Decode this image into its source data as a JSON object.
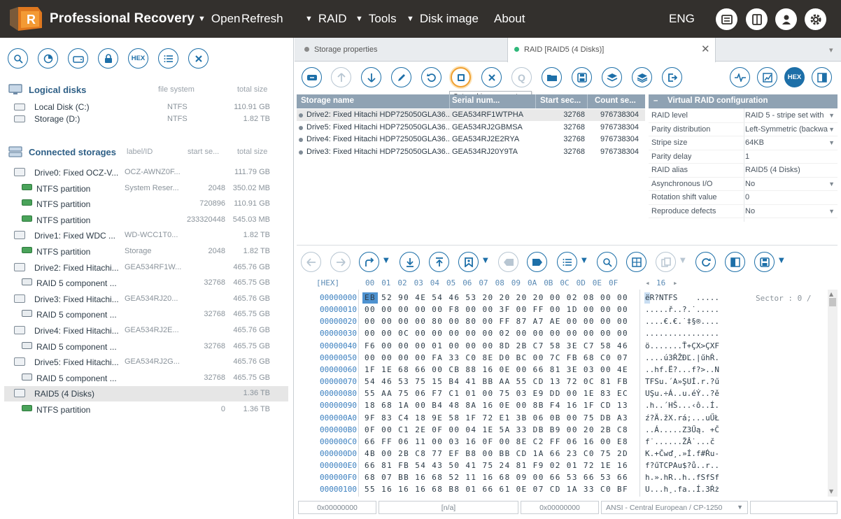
{
  "app": {
    "title": "Professional Recovery",
    "menu": [
      {
        "label": "Open",
        "has_arrow": true
      },
      {
        "label": "Refresh",
        "has_arrow": false
      },
      {
        "label": "RAID",
        "has_arrow": true
      },
      {
        "label": "Tools",
        "has_arrow": true
      },
      {
        "label": "Disk image",
        "has_arrow": true
      },
      {
        "label": "About",
        "has_arrow": false
      }
    ],
    "language": "ENG",
    "arrow": "▼"
  },
  "left": {
    "toolbar_hex": "HEX",
    "logical": {
      "title": "Logical disks",
      "col_fs": "file system",
      "col_size": "total size",
      "items": [
        {
          "name": "Local Disk (C:)",
          "fs": "NTFS",
          "size": "110.91 GB"
        },
        {
          "name": "Storage (D:)",
          "fs": "NTFS",
          "size": "1.82 TB"
        }
      ]
    },
    "connected": {
      "title": "Connected storages",
      "col_label": "label/ID",
      "col_start": "start se...",
      "col_size": "total size",
      "items": [
        {
          "kind": "drive",
          "name": "Drive0: Fixed OCZ-V...",
          "label": "OCZ-AWNZ0F...",
          "start": "",
          "size": "111.79 GB"
        },
        {
          "kind": "part",
          "name": "NTFS partition",
          "label": "System Reser...",
          "start": "2048",
          "size": "350.02 MB"
        },
        {
          "kind": "part",
          "name": "NTFS partition",
          "label": "",
          "start": "720896",
          "size": "110.91 GB"
        },
        {
          "kind": "part",
          "name": "NTFS partition",
          "label": "",
          "start": "233320448",
          "size": "545.03 MB"
        },
        {
          "kind": "drive",
          "name": "Drive1: Fixed WDC ...",
          "label": "WD-WCC1T0...",
          "start": "",
          "size": "1.82 TB"
        },
        {
          "kind": "part",
          "name": "NTFS partition",
          "label": "Storage",
          "start": "2048",
          "size": "1.82 TB"
        },
        {
          "kind": "drive",
          "name": "Drive2: Fixed Hitachi...",
          "label": "GEA534RF1W...",
          "start": "",
          "size": "465.76 GB"
        },
        {
          "kind": "raid",
          "name": "RAID 5 component ...",
          "label": "",
          "start": "32768",
          "size": "465.75 GB"
        },
        {
          "kind": "drive",
          "name": "Drive3: Fixed Hitachi...",
          "label": "GEA534RJ20...",
          "start": "",
          "size": "465.76 GB"
        },
        {
          "kind": "raid",
          "name": "RAID 5 component ...",
          "label": "",
          "start": "32768",
          "size": "465.75 GB"
        },
        {
          "kind": "drive",
          "name": "Drive4: Fixed Hitachi...",
          "label": "GEA534RJ2E...",
          "start": "",
          "size": "465.76 GB"
        },
        {
          "kind": "raid",
          "name": "RAID 5 component ...",
          "label": "",
          "start": "32768",
          "size": "465.75 GB"
        },
        {
          "kind": "drive",
          "name": "Drive5: Fixed Hitachi...",
          "label": "GEA534RJ2G...",
          "start": "",
          "size": "465.76 GB"
        },
        {
          "kind": "raid",
          "name": "RAID 5 component ...",
          "label": "",
          "start": "32768",
          "size": "465.75 GB"
        },
        {
          "kind": "drive",
          "name": "RAID5 (4 Disks)",
          "label": "",
          "start": "",
          "size": "1.36 TB",
          "selected": true
        },
        {
          "kind": "part",
          "name": "NTFS partition",
          "label": "",
          "start": "0",
          "size": "1.36 TB"
        }
      ]
    }
  },
  "tabs": [
    {
      "label": "Storage properties",
      "active": false,
      "dot": "#8a8a8a"
    },
    {
      "label": "RAID [RAID5 (4 Disks)]",
      "active": true,
      "dot": "#2fb87a"
    }
  ],
  "tooltip": "Set caching parameters",
  "hex_button": "HEX",
  "storage_table": {
    "headers": [
      "Storage name",
      "Serial num...",
      "Start sec...",
      "Count se..."
    ],
    "rows": [
      {
        "name": "Drive2: Fixed Hitachi HDP725050GLA36...",
        "serial": "GEA534RF1WTPHA",
        "start": "32768",
        "count": "976738304"
      },
      {
        "name": "Drive5: Fixed Hitachi HDP725050GLA36...",
        "serial": "GEA534RJ2GBMSA",
        "start": "32768",
        "count": "976738304"
      },
      {
        "name": "Drive4: Fixed Hitachi HDP725050GLA36...",
        "serial": "GEA534RJ2E2RYA",
        "start": "32768",
        "count": "976738304"
      },
      {
        "name": "Drive3: Fixed Hitachi HDP725050GLA36...",
        "serial": "GEA534RJ20Y9TA",
        "start": "32768",
        "count": "976738304"
      }
    ]
  },
  "raid_config": {
    "title": "Virtual RAID configuration",
    "collapse": "–",
    "rows": [
      {
        "key": "RAID level",
        "value": "RAID 5 - stripe set with",
        "dropdown": true
      },
      {
        "key": "Parity distribution",
        "value": "Left-Symmetric (backwa",
        "dropdown": true
      },
      {
        "key": "Stripe size",
        "value": "64KB",
        "dropdown": true
      },
      {
        "key": "Parity delay",
        "value": "1",
        "dropdown": false
      },
      {
        "key": "RAID alias",
        "value": "RAID5 (4 Disks)",
        "dropdown": false
      },
      {
        "key": "Asynchronous I/O",
        "value": "No",
        "dropdown": true
      },
      {
        "key": "Rotation shift value",
        "value": "0",
        "dropdown": false
      },
      {
        "key": "Reproduce defects",
        "value": "No",
        "dropdown": true
      }
    ]
  },
  "hex": {
    "header_label": "[HEX]",
    "columns": [
      "00",
      "01",
      "02",
      "03",
      "04",
      "05",
      "06",
      "07",
      "08",
      "09",
      "0A",
      "0B",
      "0C",
      "0D",
      "0E",
      "0F"
    ],
    "width_label": "16",
    "sector_label": "Sector : 0 /",
    "rows": [
      {
        "addr": "00000000",
        "bytes": "EB 52 90 4E 54 46 53 20 20 20 20 00 02 08 00 00",
        "text": "ëR?NTFS    ....."
      },
      {
        "addr": "00000010",
        "bytes": "00 00 00 00 00 F8 00 00 3F 00 FF 00 1D 00 00 00",
        "text": ".....ř..?.˙....."
      },
      {
        "addr": "00000020",
        "bytes": "00 00 00 00 80 00 80 00 FF 87 A7 AE 00 00 00 00",
        "text": "....€.€.˙‡§®...."
      },
      {
        "addr": "00000030",
        "bytes": "00 00 0C 00 00 00 00 00 02 00 00 00 00 00 00 00",
        "text": "................"
      },
      {
        "addr": "00000040",
        "bytes": "F6 00 00 00 01 00 00 00 8D 2B C7 58 3E C7 58 46",
        "text": "ö.......Ť+ÇX>ÇXF"
      },
      {
        "addr": "00000050",
        "bytes": "00 00 00 00 FA 33 C0 8E D0 BC 00 7C FB 68 C0 07",
        "text": "....ú3ŔŽĐĽ.|űhŔ."
      },
      {
        "addr": "00000060",
        "bytes": "1F 1E 68 66 00 CB 88 16 0E 00 66 81 3E 03 00 4E",
        "text": "..hf.Ë?...f?>..N"
      },
      {
        "addr": "00000070",
        "bytes": "54 46 53 75 15 B4 41 BB AA 55 CD 13 72 0C 81 FB",
        "text": "TFSu.´A»ŞUÍ.r.?ű"
      },
      {
        "addr": "00000080",
        "bytes": "55 AA 75 06 F7 C1 01 00 75 03 E9 DD 00 1E 83 EC",
        "text": "UŞu.÷Á..u.éÝ..?ě"
      },
      {
        "addr": "00000090",
        "bytes": "18 68 1A 00 B4 48 8A 16 0E 00 8B F4 16 1F CD 13",
        "text": ".h..´HŠ...‹ô..Í."
      },
      {
        "addr": "000000A0",
        "bytes": "9F 83 C4 18 9E 58 1F 72 E1 3B 06 0B 00 75 DB A3",
        "text": "ź?Ä.žX.rá;...uŰŁ"
      },
      {
        "addr": "000000B0",
        "bytes": "0F 00 C1 2E 0F 00 04 1E 5A 33 DB B9 00 20 2B C8",
        "text": "..Á.....Z3Űą. +Č"
      },
      {
        "addr": "000000C0",
        "bytes": "66 FF 06 11 00 03 16 0F 00 8E C2 FF 06 16 00 E8",
        "text": "f˙......ŽÂ˙...č"
      },
      {
        "addr": "000000D0",
        "bytes": "4B 00 2B C8 77 EF B8 00 BB CD 1A 66 23 C0 75 2D",
        "text": "K.+Čwď¸.»Í.f#Ŕu-"
      },
      {
        "addr": "000000E0",
        "bytes": "66 81 FB 54 43 50 41 75 24 81 F9 02 01 72 1E 16",
        "text": "f?űTCPAu$?ů..r.."
      },
      {
        "addr": "000000F0",
        "bytes": "68 07 BB 16 68 52 11 16 68 09 00 66 53 66 53 66",
        "text": "h.».hR..h..fSfSf"
      },
      {
        "addr": "00000100",
        "bytes": "55 16 16 16 68 B8 01 66 61 0E 07 CD 1A 33 C0 BF",
        "text": "U...h¸.fa..Í.3Ŕż"
      }
    ]
  },
  "status": {
    "offset1": "0x00000000",
    "na": "[n/a]",
    "offset2": "0x00000000",
    "encoding": "ANSI - Central European / CP-1250"
  }
}
